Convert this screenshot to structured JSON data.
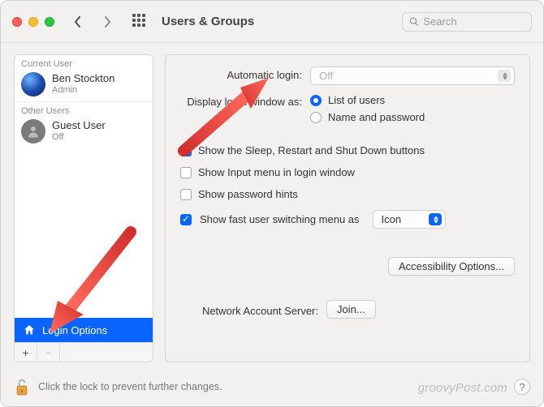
{
  "window": {
    "title": "Users & Groups",
    "search_placeholder": "Search"
  },
  "sidebar": {
    "current_label": "Current User",
    "current_user": {
      "name": "Ben Stockton",
      "role": "Admin"
    },
    "other_label": "Other Users",
    "guest_user": {
      "name": "Guest User",
      "status": "Off"
    },
    "login_options_label": "Login Options",
    "add_label": "+",
    "remove_label": "−"
  },
  "main": {
    "automatic_login_label": "Automatic login:",
    "automatic_login_value": "Off",
    "display_login_label": "Display login window as:",
    "radio_list": "List of users",
    "radio_namepw": "Name and password",
    "chk_sleep": "Show the Sleep, Restart and Shut Down buttons",
    "chk_input": "Show Input menu in login window",
    "chk_hints": "Show password hints",
    "chk_fast": "Show fast user switching menu as",
    "fast_value": "Icon",
    "accessibility_btn": "Accessibility Options...",
    "nas_label": "Network Account Server:",
    "join_btn": "Join..."
  },
  "bottom": {
    "lock_text": "Click the lock to prevent further changes.",
    "watermark": "groovyPost.com"
  }
}
